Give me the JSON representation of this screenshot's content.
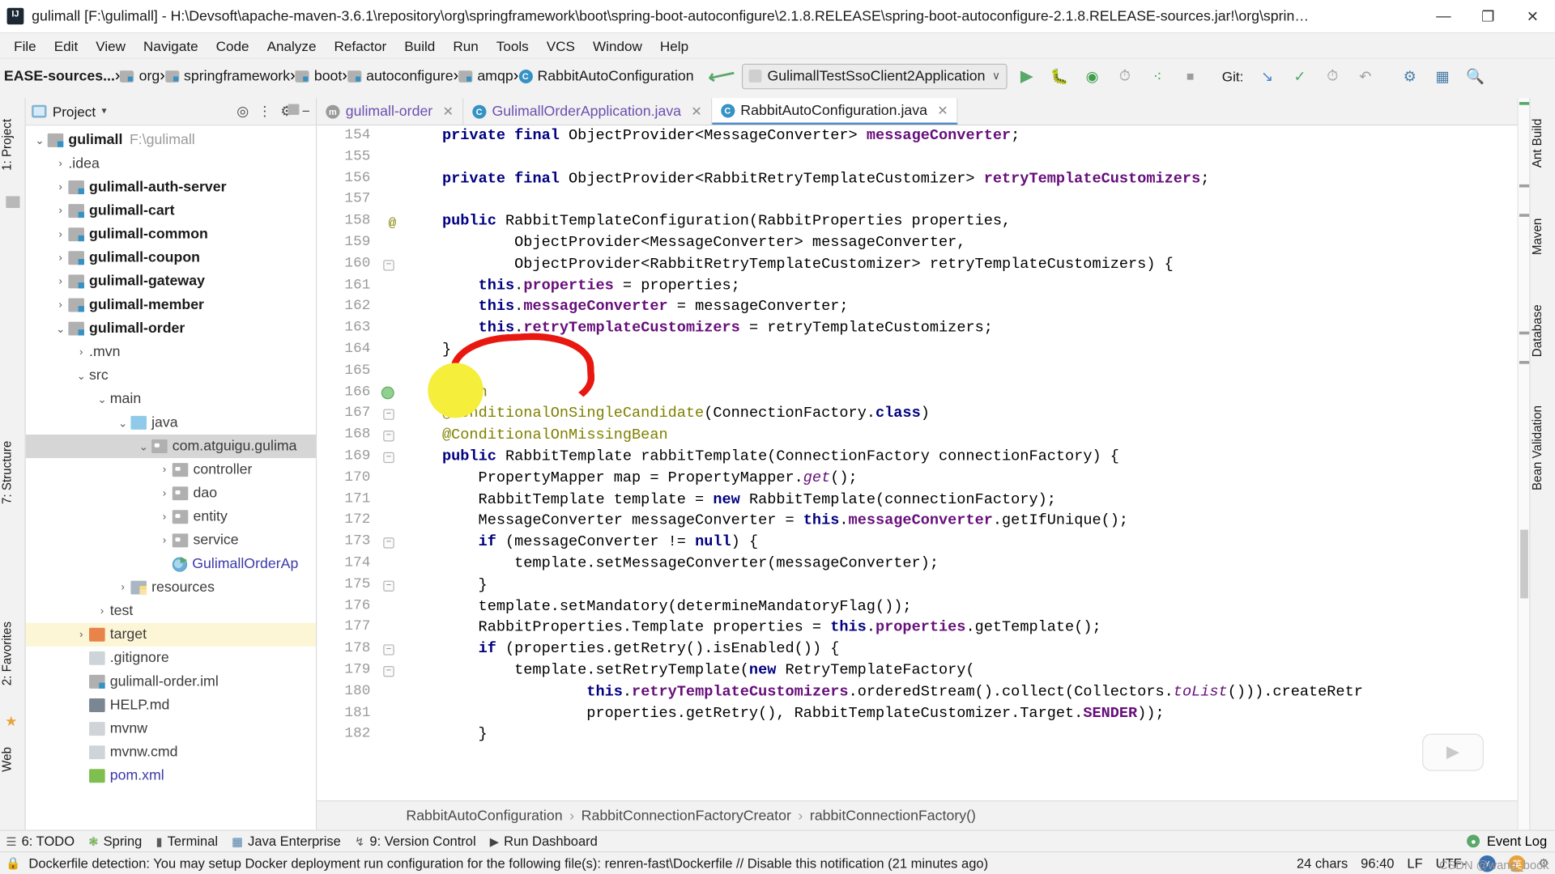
{
  "window": {
    "title": "gulimall [F:\\gulimall] - H:\\Devsoft\\apache-maven-3.6.1\\repository\\org\\springframework\\boot\\spring-boot-autoconfigure\\2.1.8.RELEASE\\spring-boot-autoconfigure-2.1.8.RELEASE-sources.jar!\\org\\springfra...",
    "minimize": "—",
    "maximize": "❐",
    "close": "✕"
  },
  "menu": [
    "File",
    "Edit",
    "View",
    "Navigate",
    "Code",
    "Analyze",
    "Refactor",
    "Build",
    "Run",
    "Tools",
    "VCS",
    "Window",
    "Help"
  ],
  "breadcrumb": [
    {
      "label": "EASE-sources...",
      "icon": "none",
      "bold": true
    },
    {
      "label": "org",
      "icon": "folder-icon",
      "bold": false
    },
    {
      "label": "springframework",
      "icon": "folder-icon",
      "bold": false
    },
    {
      "label": "boot",
      "icon": "folder-icon",
      "bold": false
    },
    {
      "label": "autoconfigure",
      "icon": "folder-icon",
      "bold": false
    },
    {
      "label": "amqp",
      "icon": "folder-icon",
      "bold": false
    },
    {
      "label": "RabbitAutoConfiguration",
      "icon": "class-icon",
      "bold": false
    }
  ],
  "toolbar": {
    "run_config": "GulimallTestSsoClient2Application",
    "run_config_caret": "∨",
    "git_label": "Git:",
    "icons": [
      "run-icon",
      "debug-icon",
      "run-with-coverage-icon",
      "profile-icon",
      "attach-debugger-icon",
      "stop-icon"
    ]
  },
  "project_panel": {
    "title": "Project",
    "caret": "▾",
    "actions": [
      "locate-icon",
      "collapse-all-icon",
      "settings-icon",
      "hide-icon"
    ],
    "tree": [
      {
        "indent": 0,
        "twisty": "∨",
        "icon": "module-icon",
        "label": "gulimall",
        "path": "F:\\gulimall",
        "style": "bold"
      },
      {
        "indent": 1,
        "twisty": "›",
        "icon": "folder-icon",
        "label": ".idea",
        "path": "",
        "style": "plain"
      },
      {
        "indent": 1,
        "twisty": "›",
        "icon": "module-icon",
        "label": "gulimall-auth-server",
        "path": "",
        "style": "bold"
      },
      {
        "indent": 1,
        "twisty": "›",
        "icon": "module-icon",
        "label": "gulimall-cart",
        "path": "",
        "style": "bold"
      },
      {
        "indent": 1,
        "twisty": "›",
        "icon": "module-icon",
        "label": "gulimall-common",
        "path": "",
        "style": "bold"
      },
      {
        "indent": 1,
        "twisty": "›",
        "icon": "module-icon",
        "label": "gulimall-coupon",
        "path": "",
        "style": "bold"
      },
      {
        "indent": 1,
        "twisty": "›",
        "icon": "module-icon",
        "label": "gulimall-gateway",
        "path": "",
        "style": "bold"
      },
      {
        "indent": 1,
        "twisty": "›",
        "icon": "module-icon",
        "label": "gulimall-member",
        "path": "",
        "style": "bold"
      },
      {
        "indent": 1,
        "twisty": "∨",
        "icon": "module-icon",
        "label": "gulimall-order",
        "path": "",
        "style": "bold"
      },
      {
        "indent": 2,
        "twisty": "›",
        "icon": "folder-icon",
        "label": ".mvn",
        "path": "",
        "style": "plain"
      },
      {
        "indent": 2,
        "twisty": "∨",
        "icon": "folder-icon",
        "label": "src",
        "path": "",
        "style": "plain"
      },
      {
        "indent": 3,
        "twisty": "∨",
        "icon": "folder-icon",
        "label": "main",
        "path": "",
        "style": "plain"
      },
      {
        "indent": 4,
        "twisty": "∨",
        "icon": "source-folder-icon",
        "label": "java",
        "path": "",
        "style": "plain"
      },
      {
        "indent": 5,
        "twisty": "∨",
        "icon": "package-icon",
        "label": "com.atguigu.gulima",
        "path": "",
        "style": "plain",
        "selected": true
      },
      {
        "indent": 6,
        "twisty": "›",
        "icon": "package-icon",
        "label": "controller",
        "path": "",
        "style": "plain"
      },
      {
        "indent": 6,
        "twisty": "›",
        "icon": "package-icon",
        "label": "dao",
        "path": "",
        "style": "plain"
      },
      {
        "indent": 6,
        "twisty": "›",
        "icon": "package-icon",
        "label": "entity",
        "path": "",
        "style": "plain"
      },
      {
        "indent": 6,
        "twisty": "›",
        "icon": "package-icon",
        "label": "service",
        "path": "",
        "style": "plain"
      },
      {
        "indent": 6,
        "twisty": "",
        "icon": "spring-boot-class-icon",
        "label": "GulimallOrderAp",
        "path": "",
        "style": "blue"
      },
      {
        "indent": 4,
        "twisty": "›",
        "icon": "resources-folder-icon",
        "label": "resources",
        "path": "",
        "style": "plain"
      },
      {
        "indent": 3,
        "twisty": "›",
        "icon": "folder-icon",
        "label": "test",
        "path": "",
        "style": "plain"
      },
      {
        "indent": 2,
        "twisty": "›",
        "icon": "target-folder-icon",
        "label": "target",
        "path": "",
        "style": "plain",
        "highlight": true
      },
      {
        "indent": 2,
        "twisty": "",
        "icon": "file-icon",
        "label": ".gitignore",
        "path": "",
        "style": "plain"
      },
      {
        "indent": 2,
        "twisty": "",
        "icon": "iml-icon",
        "label": "gulimall-order.iml",
        "path": "",
        "style": "plain"
      },
      {
        "indent": 2,
        "twisty": "",
        "icon": "md-icon",
        "label": "HELP.md",
        "path": "",
        "style": "plain"
      },
      {
        "indent": 2,
        "twisty": "",
        "icon": "file-icon",
        "label": "mvnw",
        "path": "",
        "style": "plain"
      },
      {
        "indent": 2,
        "twisty": "",
        "icon": "file-icon",
        "label": "mvnw.cmd",
        "path": "",
        "style": "plain"
      },
      {
        "indent": 2,
        "twisty": "",
        "icon": "xml-icon",
        "label": "pom.xml",
        "path": "",
        "style": "blue"
      }
    ]
  },
  "left_strip": [
    "1: Project",
    "7: Structure",
    "2: Favorites",
    "Web"
  ],
  "right_strip": [
    "Ant Build",
    "Maven",
    "Database",
    "Bean Validation"
  ],
  "tabs": [
    {
      "label": "gulimall-order",
      "icon": "maven-icon",
      "active": false,
      "close": "✕",
      "color": "normal"
    },
    {
      "label": "GulimallOrderApplication.java",
      "icon": "class-icon",
      "active": false,
      "close": "✕",
      "color": "purple"
    },
    {
      "label": "RabbitAutoConfiguration.java",
      "icon": "class-icon",
      "active": true,
      "close": "✕",
      "color": "normal"
    }
  ],
  "editor": {
    "first_line": 154,
    "lines": [
      {
        "n": 154,
        "html": "    <span class='kw'>private final</span> ObjectProvider&lt;MessageConverter&gt; <span class='fld'>messageConverter</span>;"
      },
      {
        "n": 155,
        "html": ""
      },
      {
        "n": 156,
        "html": "    <span class='kw'>private final</span> ObjectProvider&lt;RabbitRetryTemplateCustomizer&gt; <span class='fld'>retryTemplateCustomizers</span>;"
      },
      {
        "n": 157,
        "html": ""
      },
      {
        "n": 158,
        "html": "    <span class='kw'>public</span> RabbitTemplateConfiguration(RabbitProperties properties,"
      },
      {
        "n": 159,
        "html": "            ObjectProvider&lt;MessageConverter&gt; messageConverter,"
      },
      {
        "n": 160,
        "html": "            ObjectProvider&lt;RabbitRetryTemplateCustomizer&gt; retryTemplateCustomizers) {"
      },
      {
        "n": 161,
        "html": "        <span class='kw'>this</span>.<span class='fld'>properties</span> = properties;"
      },
      {
        "n": 162,
        "html": "        <span class='kw'>this</span>.<span class='fld'>messageConverter</span> = messageConverter;"
      },
      {
        "n": 163,
        "html": "        <span class='kw'>this</span>.<span class='fld'>retryTemplateCustomizers</span> = retryTemplateCustomizers;"
      },
      {
        "n": 164,
        "html": "    }"
      },
      {
        "n": 165,
        "html": ""
      },
      {
        "n": 166,
        "html": "    <span class='ann'>@Bean</span>"
      },
      {
        "n": 167,
        "html": "    <span class='ann'>@ConditionalOnSingleCandidate</span>(ConnectionFactory.<span class='kw'>class</span>)"
      },
      {
        "n": 168,
        "html": "    <span class='ann'>@ConditionalOnMissingBean</span>"
      },
      {
        "n": 169,
        "html": "    <span class='kw'>public</span> RabbitTemplate rabbitTemplate(ConnectionFactory connectionFactory) {"
      },
      {
        "n": 170,
        "html": "        PropertyMapper map = PropertyMapper.<span class='stat'>get</span>();"
      },
      {
        "n": 171,
        "html": "        RabbitTemplate template = <span class='kw'>new</span> RabbitTemplate(connectionFactory);"
      },
      {
        "n": 172,
        "html": "        MessageConverter messageConverter = <span class='kw'>this</span>.<span class='fld'>messageConverter</span>.getIfUnique();"
      },
      {
        "n": 173,
        "html": "        <span class='kw'>if</span> (messageConverter != <span class='kw'>null</span>) {"
      },
      {
        "n": 174,
        "html": "            template.setMessageConverter(messageConverter);"
      },
      {
        "n": 175,
        "html": "        }"
      },
      {
        "n": 176,
        "html": "        template.setMandatory(determineMandatoryFlag());"
      },
      {
        "n": 177,
        "html": "        RabbitProperties.Template properties = <span class='kw'>this</span>.<span class='fld'>properties</span>.getTemplate();"
      },
      {
        "n": 178,
        "html": "        <span class='kw'>if</span> (properties.getRetry().isEnabled()) {"
      },
      {
        "n": 179,
        "html": "            template.setRetryTemplate(<span class='kw'>new</span> RetryTemplateFactory("
      },
      {
        "n": 180,
        "html": "                    <span class='kw'>this</span>.<span class='fld'>retryTemplateCustomizers</span>.orderedStream().collect(Collectors.<span class='stat'>toList</span>())).createRetr"
      },
      {
        "n": 181,
        "html": "                    properties.getRetry(), RabbitTemplateCustomizer.Target.<span class='fld'>SENDER</span>));"
      },
      {
        "n": 182,
        "html": "        }"
      }
    ],
    "breadcrumbs": [
      "RabbitAutoConfiguration",
      "RabbitConnectionFactoryCreator",
      "rabbitConnectionFactory()"
    ],
    "breadcrumb_sep": "›"
  },
  "bottom_tools": [
    {
      "icon": "todo-icon",
      "label": "6: TODO"
    },
    {
      "icon": "spring-icon",
      "label": "Spring"
    },
    {
      "icon": "terminal-icon",
      "label": "Terminal"
    },
    {
      "icon": "java-enterprise-icon",
      "label": "Java Enterprise"
    },
    {
      "icon": "version-control-icon",
      "label": "9: Version Control"
    },
    {
      "icon": "run-dashboard-icon",
      "label": "Run Dashboard"
    }
  ],
  "bottom_right": {
    "event_log": "Event Log",
    "event_icon": "event-log-icon"
  },
  "status": {
    "message": "Dockerfile detection: You may setup Docker deployment run configuration for the following file(s): renren-fast\\Dockerfile // Disable this notification (21 minutes ago)",
    "chars": "24 chars",
    "caret": "96:40",
    "line_sep": "LF",
    "encoding": "UTF-",
    "ime_cn": "英",
    "ime_mark": "ʘ",
    "lock_icon": "lock-icon"
  },
  "watermark": "CSDN @wang_book",
  "annotations": {
    "red_circle": "hand-drawn-red-circle-around-bean-annotation",
    "yellow_dot": "yellow-highlight-dot"
  },
  "colors": {
    "accent": "#3592c4",
    "run_green": "#59a869",
    "annotation_red": "#e8170f",
    "annotation_yellow": "#f5ee3a",
    "keyword": "#000080",
    "annotation_text": "#808000",
    "field": "#660e7a"
  }
}
